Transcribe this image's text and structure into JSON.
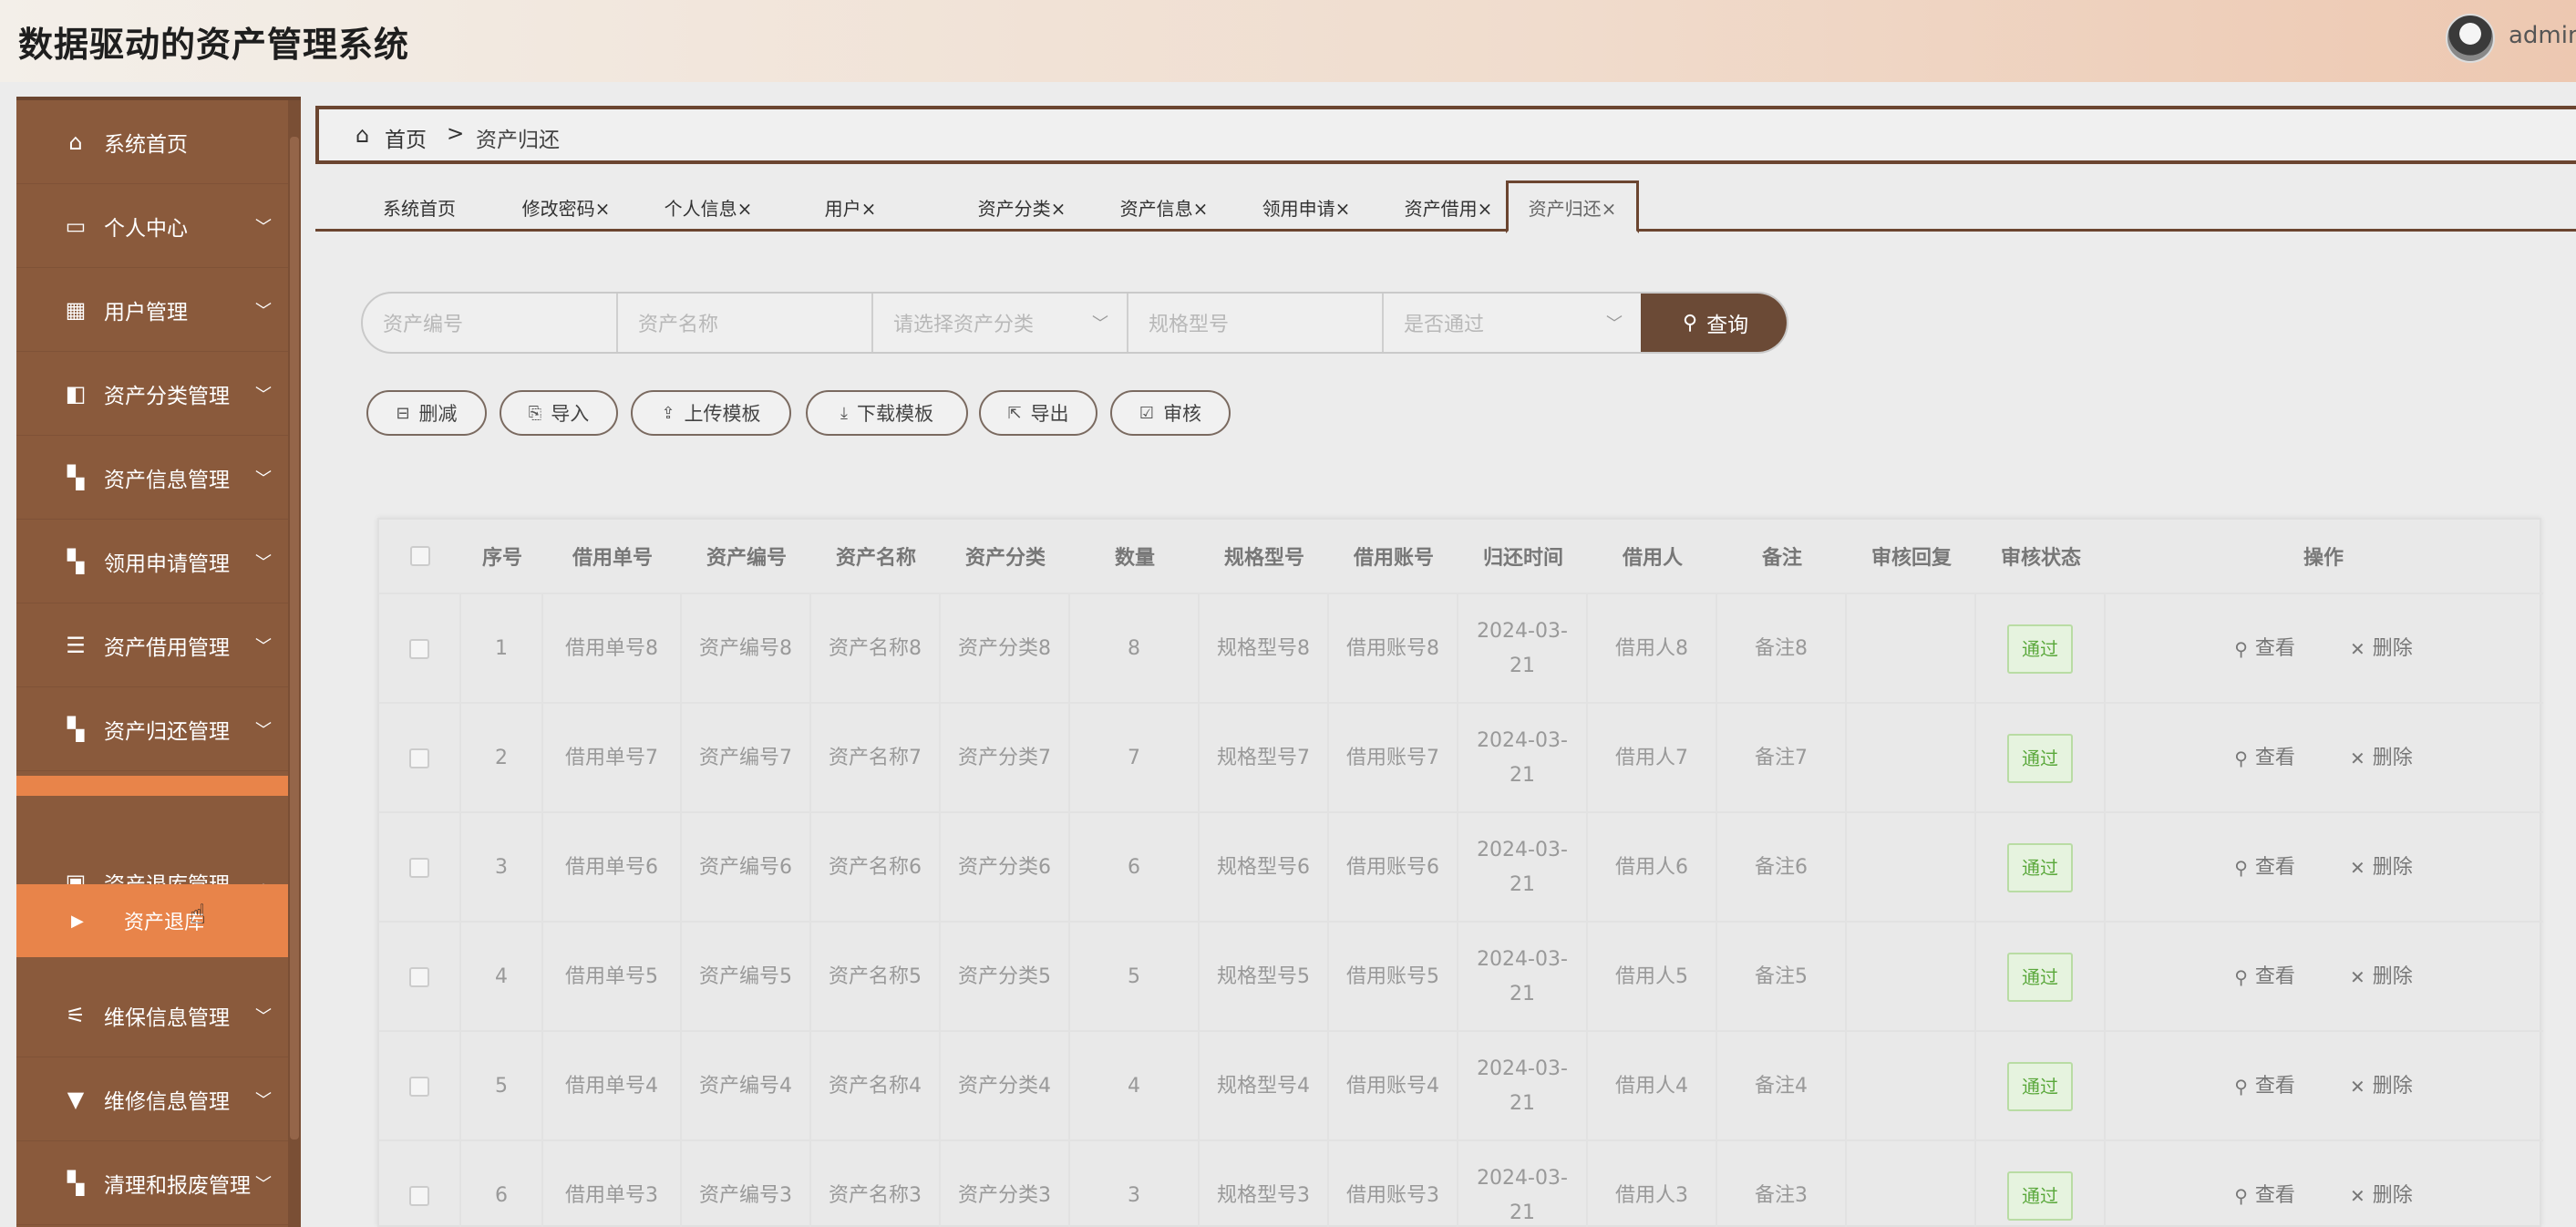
{
  "header": {
    "title": "数据驱动的资产管理系统",
    "username": "admin"
  },
  "sidebar": {
    "items": [
      {
        "label": "系统首页",
        "icon": "home-icon",
        "arrow": ""
      },
      {
        "label": "个人中心",
        "icon": "card-icon",
        "arrow": "﹀"
      },
      {
        "label": "用户管理",
        "icon": "grid-icon",
        "arrow": "﹀"
      },
      {
        "label": "资产分类管理",
        "icon": "wallet-icon",
        "arrow": "﹀"
      },
      {
        "label": "资产信息管理",
        "icon": "blocks-icon",
        "arrow": "﹀"
      },
      {
        "label": "领用申请管理",
        "icon": "blocks-icon",
        "arrow": "﹀"
      },
      {
        "label": "资产借用管理",
        "icon": "list-icon",
        "arrow": "﹀"
      },
      {
        "label": "资产归还管理",
        "icon": "blocks-icon",
        "arrow": "﹀"
      },
      {
        "label": "资产退库管理",
        "icon": "briefcase-icon",
        "arrow": "︿"
      },
      {
        "label": "维保信息管理",
        "icon": "sliders-icon",
        "arrow": "﹀"
      },
      {
        "label": "维修信息管理",
        "icon": "stamp-icon",
        "arrow": "﹀"
      },
      {
        "label": "清理和报废管理",
        "icon": "blocks-icon",
        "arrow": "﹀"
      }
    ],
    "submenu_label": "资产退库"
  },
  "breadcrumb": {
    "home": "首页",
    "separator": ">",
    "current": "资产归还"
  },
  "tabs": [
    {
      "label": "系统首页"
    },
    {
      "label": "修改密码×"
    },
    {
      "label": "个人信息×"
    },
    {
      "label": "用户×"
    },
    {
      "label": "资产分类×"
    },
    {
      "label": "资产信息×"
    },
    {
      "label": "领用申请×"
    },
    {
      "label": "资产借用×"
    },
    {
      "label": "资产归还×"
    }
  ],
  "search": {
    "fields": [
      {
        "placeholder": "资产编号"
      },
      {
        "placeholder": "资产名称"
      },
      {
        "placeholder": "请选择资产分类"
      },
      {
        "placeholder": "规格型号"
      },
      {
        "placeholder": "是否通过"
      }
    ],
    "button": "查询"
  },
  "actions": [
    {
      "label": "删减",
      "icon": "⊟"
    },
    {
      "label": "导入",
      "icon": "⎘"
    },
    {
      "label": "上传模板",
      "icon": "⇪"
    },
    {
      "label": "下载模板",
      "icon": "⤓"
    },
    {
      "label": "导出",
      "icon": "⇱"
    },
    {
      "label": "审核",
      "icon": "☑"
    }
  ],
  "table": {
    "headers": [
      "序号",
      "借用单号",
      "资产编号",
      "资产名称",
      "资产分类",
      "数量",
      "规格型号",
      "借用账号",
      "归还时间",
      "借用人",
      "备注",
      "审核回复",
      "审核状态",
      "操作"
    ],
    "rows": [
      {
        "no": "1",
        "loan_no": "借用单号8",
        "asset_no": "资产编号8",
        "asset_name": "资产名称8",
        "category": "资产分类8",
        "qty": "8",
        "spec": "规格型号8",
        "account": "借用账号8",
        "return_time": "2024-03-\n21",
        "borrower": "借用人8",
        "remark": "备注8",
        "reply": "",
        "status": "通过"
      },
      {
        "no": "2",
        "loan_no": "借用单号7",
        "asset_no": "资产编号7",
        "asset_name": "资产名称7",
        "category": "资产分类7",
        "qty": "7",
        "spec": "规格型号7",
        "account": "借用账号7",
        "return_time": "2024-03-\n21",
        "borrower": "借用人7",
        "remark": "备注7",
        "reply": "",
        "status": "通过"
      },
      {
        "no": "3",
        "loan_no": "借用单号6",
        "asset_no": "资产编号6",
        "asset_name": "资产名称6",
        "category": "资产分类6",
        "qty": "6",
        "spec": "规格型号6",
        "account": "借用账号6",
        "return_time": "2024-03-\n21",
        "borrower": "借用人6",
        "remark": "备注6",
        "reply": "",
        "status": "通过"
      },
      {
        "no": "4",
        "loan_no": "借用单号5",
        "asset_no": "资产编号5",
        "asset_name": "资产名称5",
        "category": "资产分类5",
        "qty": "5",
        "spec": "规格型号5",
        "account": "借用账号5",
        "return_time": "2024-03-\n21",
        "borrower": "借用人5",
        "remark": "备注5",
        "reply": "",
        "status": "通过"
      },
      {
        "no": "5",
        "loan_no": "借用单号4",
        "asset_no": "资产编号4",
        "asset_name": "资产名称4",
        "category": "资产分类4",
        "qty": "4",
        "spec": "规格型号4",
        "account": "借用账号4",
        "return_time": "2024-03-\n21",
        "borrower": "借用人4",
        "remark": "备注4",
        "reply": "",
        "status": "通过"
      },
      {
        "no": "6",
        "loan_no": "借用单号3",
        "asset_no": "资产编号3",
        "asset_name": "资产名称3",
        "category": "资产分类3",
        "qty": "3",
        "spec": "规格型号3",
        "account": "借用账号3",
        "return_time": "2024-03-\n21",
        "borrower": "借用人3",
        "remark": "备注3",
        "reply": "",
        "status": "通过"
      }
    ],
    "view_label": "查看",
    "delete_label": "删除"
  }
}
